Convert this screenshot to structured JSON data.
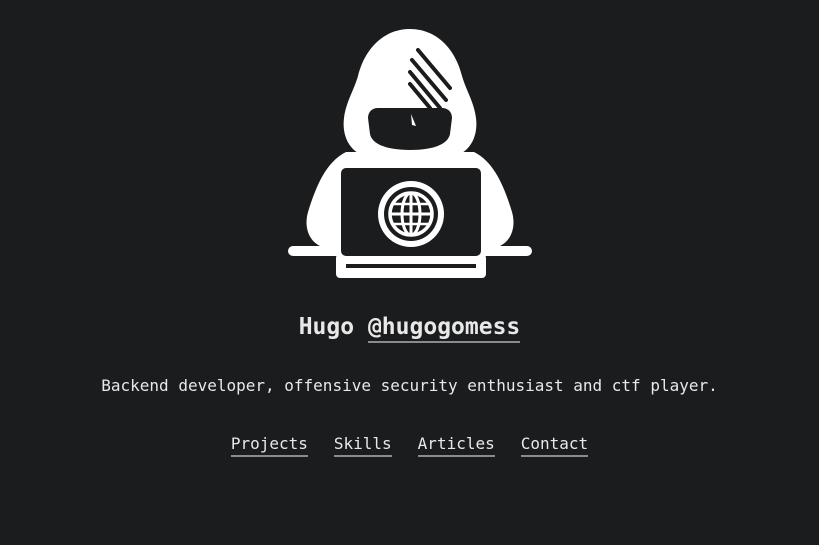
{
  "profile": {
    "avatar_icon": "hacker-hoodie-laptop-icon",
    "name": "Hugo",
    "handle": "@hugogomess",
    "bio": "Backend developer, offensive security enthusiast and ctf player."
  },
  "nav": {
    "items": [
      {
        "label": "Projects"
      },
      {
        "label": "Skills"
      },
      {
        "label": "Articles"
      },
      {
        "label": "Contact"
      }
    ]
  },
  "colors": {
    "background": "#1b1c1e",
    "text": "#e8e8e8",
    "underline": "#8a8b8d"
  }
}
